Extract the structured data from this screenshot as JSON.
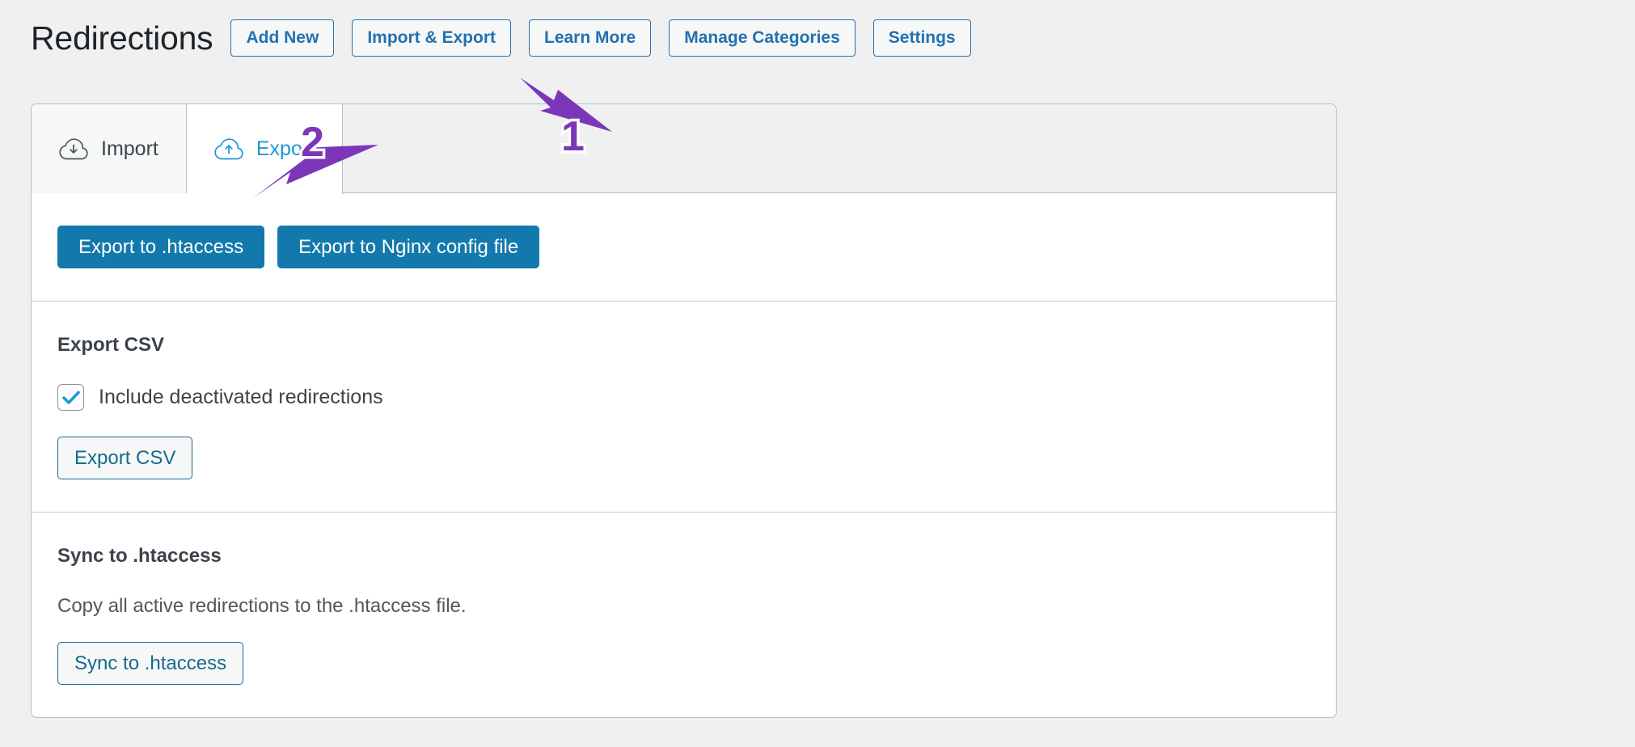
{
  "header": {
    "title": "Redirections",
    "buttons": [
      {
        "label": "Add New",
        "name": "add-new-button"
      },
      {
        "label": "Import & Export",
        "name": "import-export-button"
      },
      {
        "label": "Learn More",
        "name": "learn-more-button"
      },
      {
        "label": "Manage Categories",
        "name": "manage-categories-button"
      },
      {
        "label": "Settings",
        "name": "settings-button"
      }
    ]
  },
  "tabs": [
    {
      "label": "Import",
      "icon": "cloud-download-icon",
      "active": false
    },
    {
      "label": "Export",
      "icon": "cloud-upload-icon",
      "active": true
    }
  ],
  "export_panel": {
    "server_buttons": [
      {
        "label": "Export to .htaccess"
      },
      {
        "label": "Export to Nginx config file"
      }
    ],
    "csv": {
      "heading": "Export CSV",
      "checkbox_label": "Include deactivated redirections",
      "checkbox_checked": "true",
      "button_label": "Export CSV"
    },
    "sync": {
      "heading": "Sync to .htaccess",
      "description": "Copy all active redirections to the .htaccess file.",
      "button_label": "Sync to .htaccess"
    }
  },
  "annotations": [
    {
      "number": "1",
      "target": "import-export-button"
    },
    {
      "number": "2",
      "target": "tab-export"
    }
  ],
  "colors": {
    "accent_blue": "#2271b1",
    "primary_button": "#1379ad",
    "active_tab_text": "#2196d6",
    "annotation_purple": "#7b37b8",
    "page_background": "#f0f0f1"
  }
}
